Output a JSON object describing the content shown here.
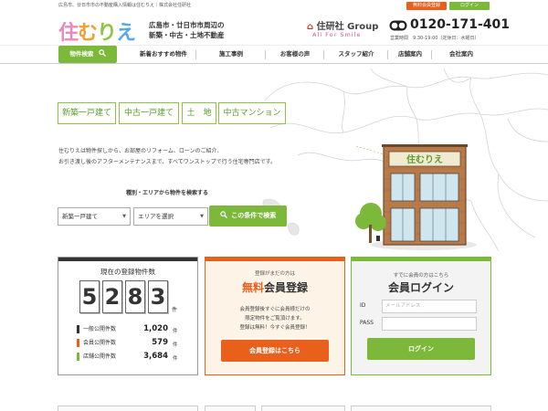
{
  "topbar": {
    "text": "広島市、廿日市市の不動産購入情報は住むりえ｜株式会社住研社",
    "register_label": "無料会員登録",
    "login_label": "ログイン"
  },
  "header": {
    "logo_chars": [
      "住",
      "む",
      "り",
      "え"
    ],
    "tagline_line1": "広島市・廿日市市周辺の",
    "tagline_line2": "新築・中古・土地不動産",
    "group_mark": "⌂",
    "group_name": "住研社 Group",
    "group_slogan": "All For Smile",
    "phone": "0120-171-401",
    "hours": "営業時間　9:30-19:00（定休日：水曜日）"
  },
  "nav": {
    "items": [
      {
        "label": "物件検索"
      },
      {
        "label": "新着おすすめ物件"
      },
      {
        "label": "施工事例"
      },
      {
        "label": "お客様の声"
      },
      {
        "label": "スタッフ紹介"
      },
      {
        "label": "店舗案内"
      },
      {
        "label": "会社案内"
      }
    ]
  },
  "hero": {
    "property_types": [
      "新築一戸建て",
      "中古一戸建て",
      "土　地",
      "中古マンション"
    ],
    "intro_line1": "住むりえは物件探しから、お部屋のリフォーム、ローンのご紹介、",
    "intro_line2": "お引き渡し後のアフターメンテナンスまで、すべてワンストップで行う住宅専門店です。",
    "building_sign": "住むりえ"
  },
  "search": {
    "heading": "種別・エリアから物件を検索する",
    "type_value": "新築一戸建て",
    "area_value": "エリアを選択",
    "button_label": "この条件で検索"
  },
  "count_panel": {
    "title": "現在の登録物件数",
    "digits": [
      "5",
      "2",
      "8",
      "3"
    ],
    "unit": "件",
    "rows": [
      {
        "label": "一般公開件数",
        "value": "1,020",
        "unit": "件",
        "color": "#333333"
      },
      {
        "label": "会員公開件数",
        "value": "579",
        "unit": "件",
        "color": "#e8601c"
      },
      {
        "label": "店舗公開件数",
        "value": "3,684",
        "unit": "件",
        "color": "#7cb83a"
      }
    ]
  },
  "register_panel": {
    "top": "登録がまだの方は",
    "title_free": "無料",
    "title_rest": "会員登録",
    "desc1": "会員登録後すぐに会員様だけの",
    "desc2": "限定物件をご覧頂けます。",
    "desc3": "登録は無料！今すぐ会員登録！",
    "button_label": "会員登録はこちら"
  },
  "login_panel": {
    "top": "すでに会員の方はこちら",
    "title": "会員ログイン",
    "id_label": "ID",
    "id_placeholder": "メールアドレス",
    "pass_label": "PASS",
    "pass_placeholder": "",
    "button_label": "ログイン"
  },
  "colors": {
    "green": "#7cb83a",
    "orange": "#e8601c",
    "dark": "#333333"
  },
  "icons": {
    "search": "magnifier-icon",
    "phone": "freedial-icon",
    "select_arrow": "triangle-down-icon"
  }
}
